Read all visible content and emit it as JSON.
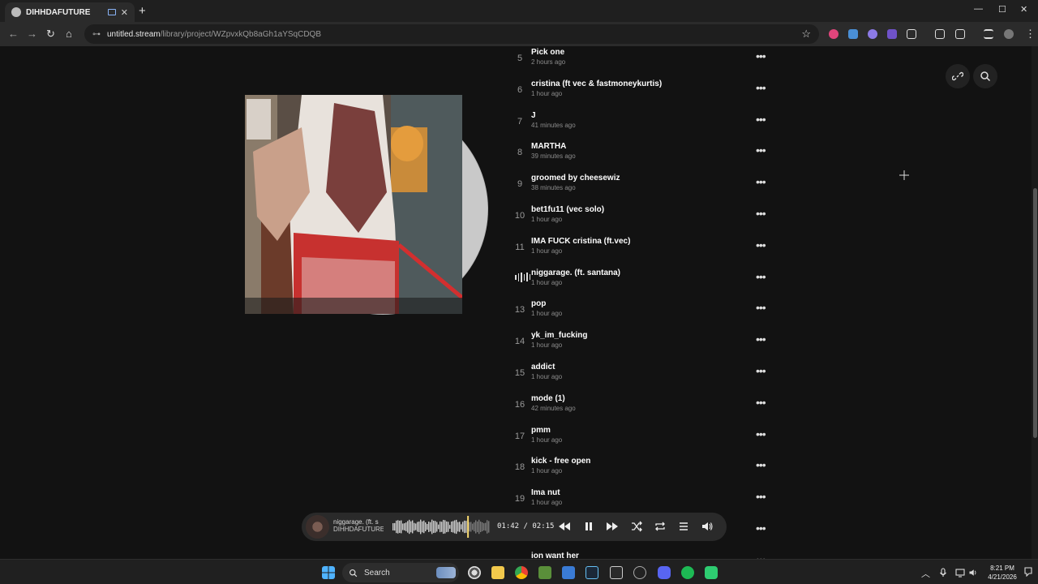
{
  "browser": {
    "tab_title": "DIHHDAFUTURE",
    "new_tab": "+",
    "url_host": "untitled.stream",
    "url_path": "/library/project/WZpvxkQb8aGh1aYSqCDQB",
    "window_controls": [
      "—",
      "☐",
      "✕"
    ]
  },
  "tracks": [
    {
      "num": "5",
      "name": "Pick one",
      "time": "2 hours ago"
    },
    {
      "num": "6",
      "name": "cristina (ft vec & fastmoneykurtis)",
      "time": "1 hour ago"
    },
    {
      "num": "7",
      "name": "J",
      "time": "41 minutes ago"
    },
    {
      "num": "8",
      "name": "MARTHA",
      "time": "39 minutes ago"
    },
    {
      "num": "9",
      "name": "groomed by cheesewiz",
      "time": "38 minutes ago"
    },
    {
      "num": "10",
      "name": "bet1fu11 (vec solo)",
      "time": "1 hour ago"
    },
    {
      "num": "11",
      "name": "IMA FUCK cristina (ft.vec)",
      "time": "1 hour ago"
    },
    {
      "num": "",
      "name": "niggarage. (ft. santana)",
      "time": "1 hour ago",
      "playing": true
    },
    {
      "num": "13",
      "name": "pop",
      "time": "1 hour ago"
    },
    {
      "num": "14",
      "name": "yk_im_fucking",
      "time": "1 hour ago"
    },
    {
      "num": "15",
      "name": "addict",
      "time": "1 hour ago"
    },
    {
      "num": "16",
      "name": "mode (1)",
      "time": "42 minutes ago"
    },
    {
      "num": "17",
      "name": "pmm",
      "time": "1 hour ago"
    },
    {
      "num": "18",
      "name": "kick - free open",
      "time": "1 hour ago"
    },
    {
      "num": "19",
      "name": "Ima nut",
      "time": "1 hour ago"
    },
    {
      "num": "",
      "name": "",
      "time": ""
    },
    {
      "num": "",
      "name": "ion want her",
      "time": ""
    }
  ],
  "player": {
    "title": "niggarage. (ft. s",
    "artist": "DIHHDAFUTURE",
    "current": "01:42",
    "sep": "/",
    "total": "02:15",
    "progress": 0.755
  },
  "taskbar": {
    "search_label": "Search",
    "time": "8:21 PM",
    "date": "4/21/2026"
  },
  "colors": {
    "background": "#121212",
    "player_bg": "#2a2a2a",
    "progress": "#f5d76e"
  }
}
